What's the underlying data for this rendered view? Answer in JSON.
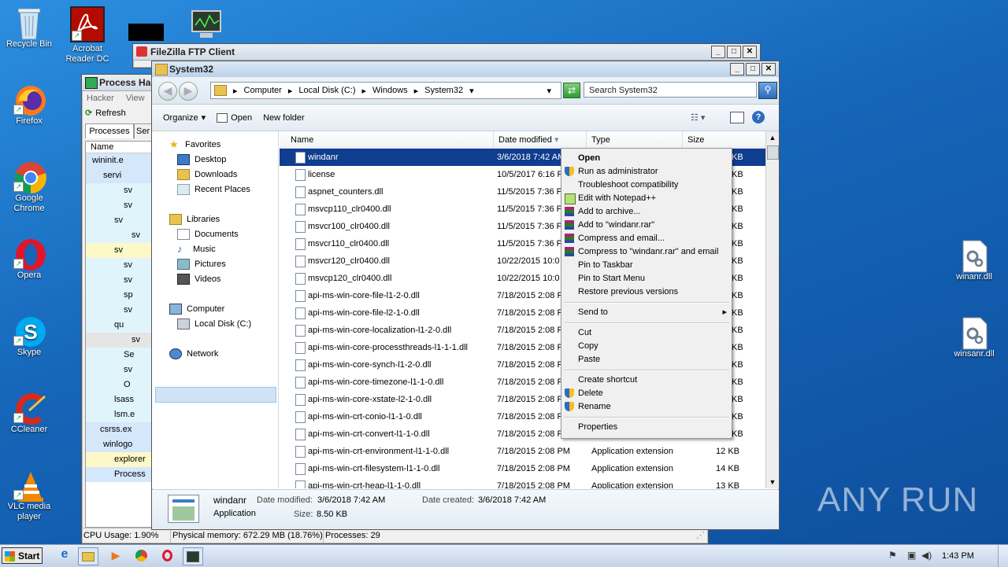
{
  "desktop_icons": [
    {
      "label": "Recycle Bin"
    },
    {
      "label": "Acrobat Reader DC"
    },
    {
      "label": "Firefox"
    },
    {
      "label": "Google Chrome"
    },
    {
      "label": "Opera"
    },
    {
      "label": "Skype"
    },
    {
      "label": "CCleaner"
    },
    {
      "label": "VLC media player"
    },
    {
      "label": "winanr.dll"
    },
    {
      "label": "winsanr.dll"
    }
  ],
  "filezilla": {
    "title": "FileZilla FTP Client"
  },
  "process_hacker": {
    "title": "Process Hac",
    "menu": [
      "Hacker",
      "View"
    ],
    "refresh_label": "Refresh",
    "tabs": [
      "Processes",
      "Ser"
    ],
    "col_name": "Name",
    "rows": [
      "wininit.e",
      "servi",
      "sv",
      "sv",
      "sv",
      "sv",
      "sv",
      "sv",
      "sv",
      "sp",
      "sv",
      "qu",
      "sv",
      "Se",
      "sv",
      "O",
      "lsass",
      "lsm.e",
      "csrss.ex",
      "winlogo",
      "explorer",
      "Process"
    ],
    "status": {
      "cpu": "CPU Usage: 1.90%",
      "mem": "Physical memory: 672.29 MB (18.76%)",
      "procs": "Processes: 29"
    }
  },
  "explorer": {
    "title": "System32",
    "breadcrumb": [
      "Computer",
      "Local Disk (C:)",
      "Windows",
      "System32"
    ],
    "search_placeholder": "Search System32",
    "toolbar": {
      "organize": "Organize",
      "open": "Open",
      "new_folder": "New folder"
    },
    "nav": {
      "favorites": "Favorites",
      "desktop": "Desktop",
      "downloads": "Downloads",
      "recent": "Recent Places",
      "libraries": "Libraries",
      "documents": "Documents",
      "music": "Music",
      "pictures": "Pictures",
      "videos": "Videos",
      "computer": "Computer",
      "local_disk": "Local Disk (C:)",
      "network": "Network"
    },
    "columns": {
      "name": "Name",
      "date": "Date modified",
      "type": "Type",
      "size": "Size"
    },
    "files": [
      {
        "name": "windanr",
        "date": "3/6/2018 7:42 AM",
        "type": "",
        "size": ""
      },
      {
        "name": "license",
        "date": "10/5/2017 6:16 P",
        "type": "",
        "size": ""
      },
      {
        "name": "aspnet_counters.dll",
        "date": "11/5/2015 7:36 P",
        "type": "",
        "size": ""
      },
      {
        "name": "msvcp110_clr0400.dll",
        "date": "11/5/2015 7:36 P",
        "type": "",
        "size": ""
      },
      {
        "name": "msvcr100_clr0400.dll",
        "date": "11/5/2015 7:36 P",
        "type": "",
        "size": ""
      },
      {
        "name": "msvcr110_clr0400.dll",
        "date": "11/5/2015 7:36 P",
        "type": "",
        "size": ""
      },
      {
        "name": "msvcr120_clr0400.dll",
        "date": "10/22/2015 10:0",
        "type": "",
        "size": ""
      },
      {
        "name": "msvcp120_clr0400.dll",
        "date": "10/22/2015 10:0",
        "type": "",
        "size": ""
      },
      {
        "name": "api-ms-win-core-file-l1-2-0.dll",
        "date": "7/18/2015 2:08 P",
        "type": "",
        "size": ""
      },
      {
        "name": "api-ms-win-core-file-l2-1-0.dll",
        "date": "7/18/2015 2:08 P",
        "type": "",
        "size": ""
      },
      {
        "name": "api-ms-win-core-localization-l1-2-0.dll",
        "date": "7/18/2015 2:08 P",
        "type": "",
        "size": ""
      },
      {
        "name": "api-ms-win-core-processthreads-l1-1-1.dll",
        "date": "7/18/2015 2:08 P",
        "type": "",
        "size": ""
      },
      {
        "name": "api-ms-win-core-synch-l1-2-0.dll",
        "date": "7/18/2015 2:08 P",
        "type": "",
        "size": ""
      },
      {
        "name": "api-ms-win-core-timezone-l1-1-0.dll",
        "date": "7/18/2015 2:08 P",
        "type": "",
        "size": ""
      },
      {
        "name": "api-ms-win-core-xstate-l2-1-0.dll",
        "date": "7/18/2015 2:08 P",
        "type": "",
        "size": ""
      },
      {
        "name": "api-ms-win-crt-conio-l1-1-0.dll",
        "date": "7/18/2015 2:08 P",
        "type": "",
        "size": ""
      },
      {
        "name": "api-ms-win-crt-convert-l1-1-0.dll",
        "date": "7/18/2015 2:08 P",
        "type": "",
        "size": ""
      },
      {
        "name": "api-ms-win-crt-environment-l1-1-0.dll",
        "date": "7/18/2015 2:08 PM",
        "type": "Application extension",
        "size": "12 KB"
      },
      {
        "name": "api-ms-win-crt-filesystem-l1-1-0.dll",
        "date": "7/18/2015 2:08 PM",
        "type": "Application extension",
        "size": "14 KB"
      },
      {
        "name": "api-ms-win-crt-heap-l1-1-0.dll",
        "date": "7/18/2015 2:08 PM",
        "type": "Application extension",
        "size": "13 KB"
      }
    ],
    "size_partial": "KB",
    "details": {
      "name": "windanr",
      "type": "Application",
      "modified_label": "Date modified:",
      "modified": "3/6/2018 7:42 AM",
      "created_label": "Date created:",
      "created": "3/6/2018 7:42 AM",
      "size_label": "Size:",
      "size": "8.50 KB"
    }
  },
  "context_menu": {
    "items": [
      {
        "label": "Open",
        "bold": true
      },
      {
        "label": "Run as administrator",
        "icon": "shield"
      },
      {
        "label": "Troubleshoot compatibility"
      },
      {
        "label": "Edit with Notepad++",
        "icon": "notepad"
      },
      {
        "label": "Add to archive...",
        "icon": "rar"
      },
      {
        "label": "Add to \"windanr.rar\"",
        "icon": "rar"
      },
      {
        "label": "Compress and email...",
        "icon": "rar"
      },
      {
        "label": "Compress to \"windanr.rar\" and email",
        "icon": "rar"
      },
      {
        "label": "Pin to Taskbar"
      },
      {
        "label": "Pin to Start Menu"
      },
      {
        "label": "Restore previous versions"
      },
      {
        "label": "Send to",
        "sep_before": true,
        "submenu": true
      },
      {
        "label": "Cut",
        "sep_before": true
      },
      {
        "label": "Copy"
      },
      {
        "label": "Paste"
      },
      {
        "label": "Create shortcut",
        "sep_before": true
      },
      {
        "label": "Delete",
        "icon": "shield"
      },
      {
        "label": "Rename",
        "icon": "shield"
      },
      {
        "label": "Properties",
        "sep_before": true
      }
    ]
  },
  "taskbar": {
    "start": "Start",
    "time": "1:43 PM"
  },
  "watermark": "ANY RUN",
  "colors": {
    "selection": "#0f3d8f",
    "desktop": "#1a74c8",
    "nav_selected": "#cfe3f7"
  }
}
